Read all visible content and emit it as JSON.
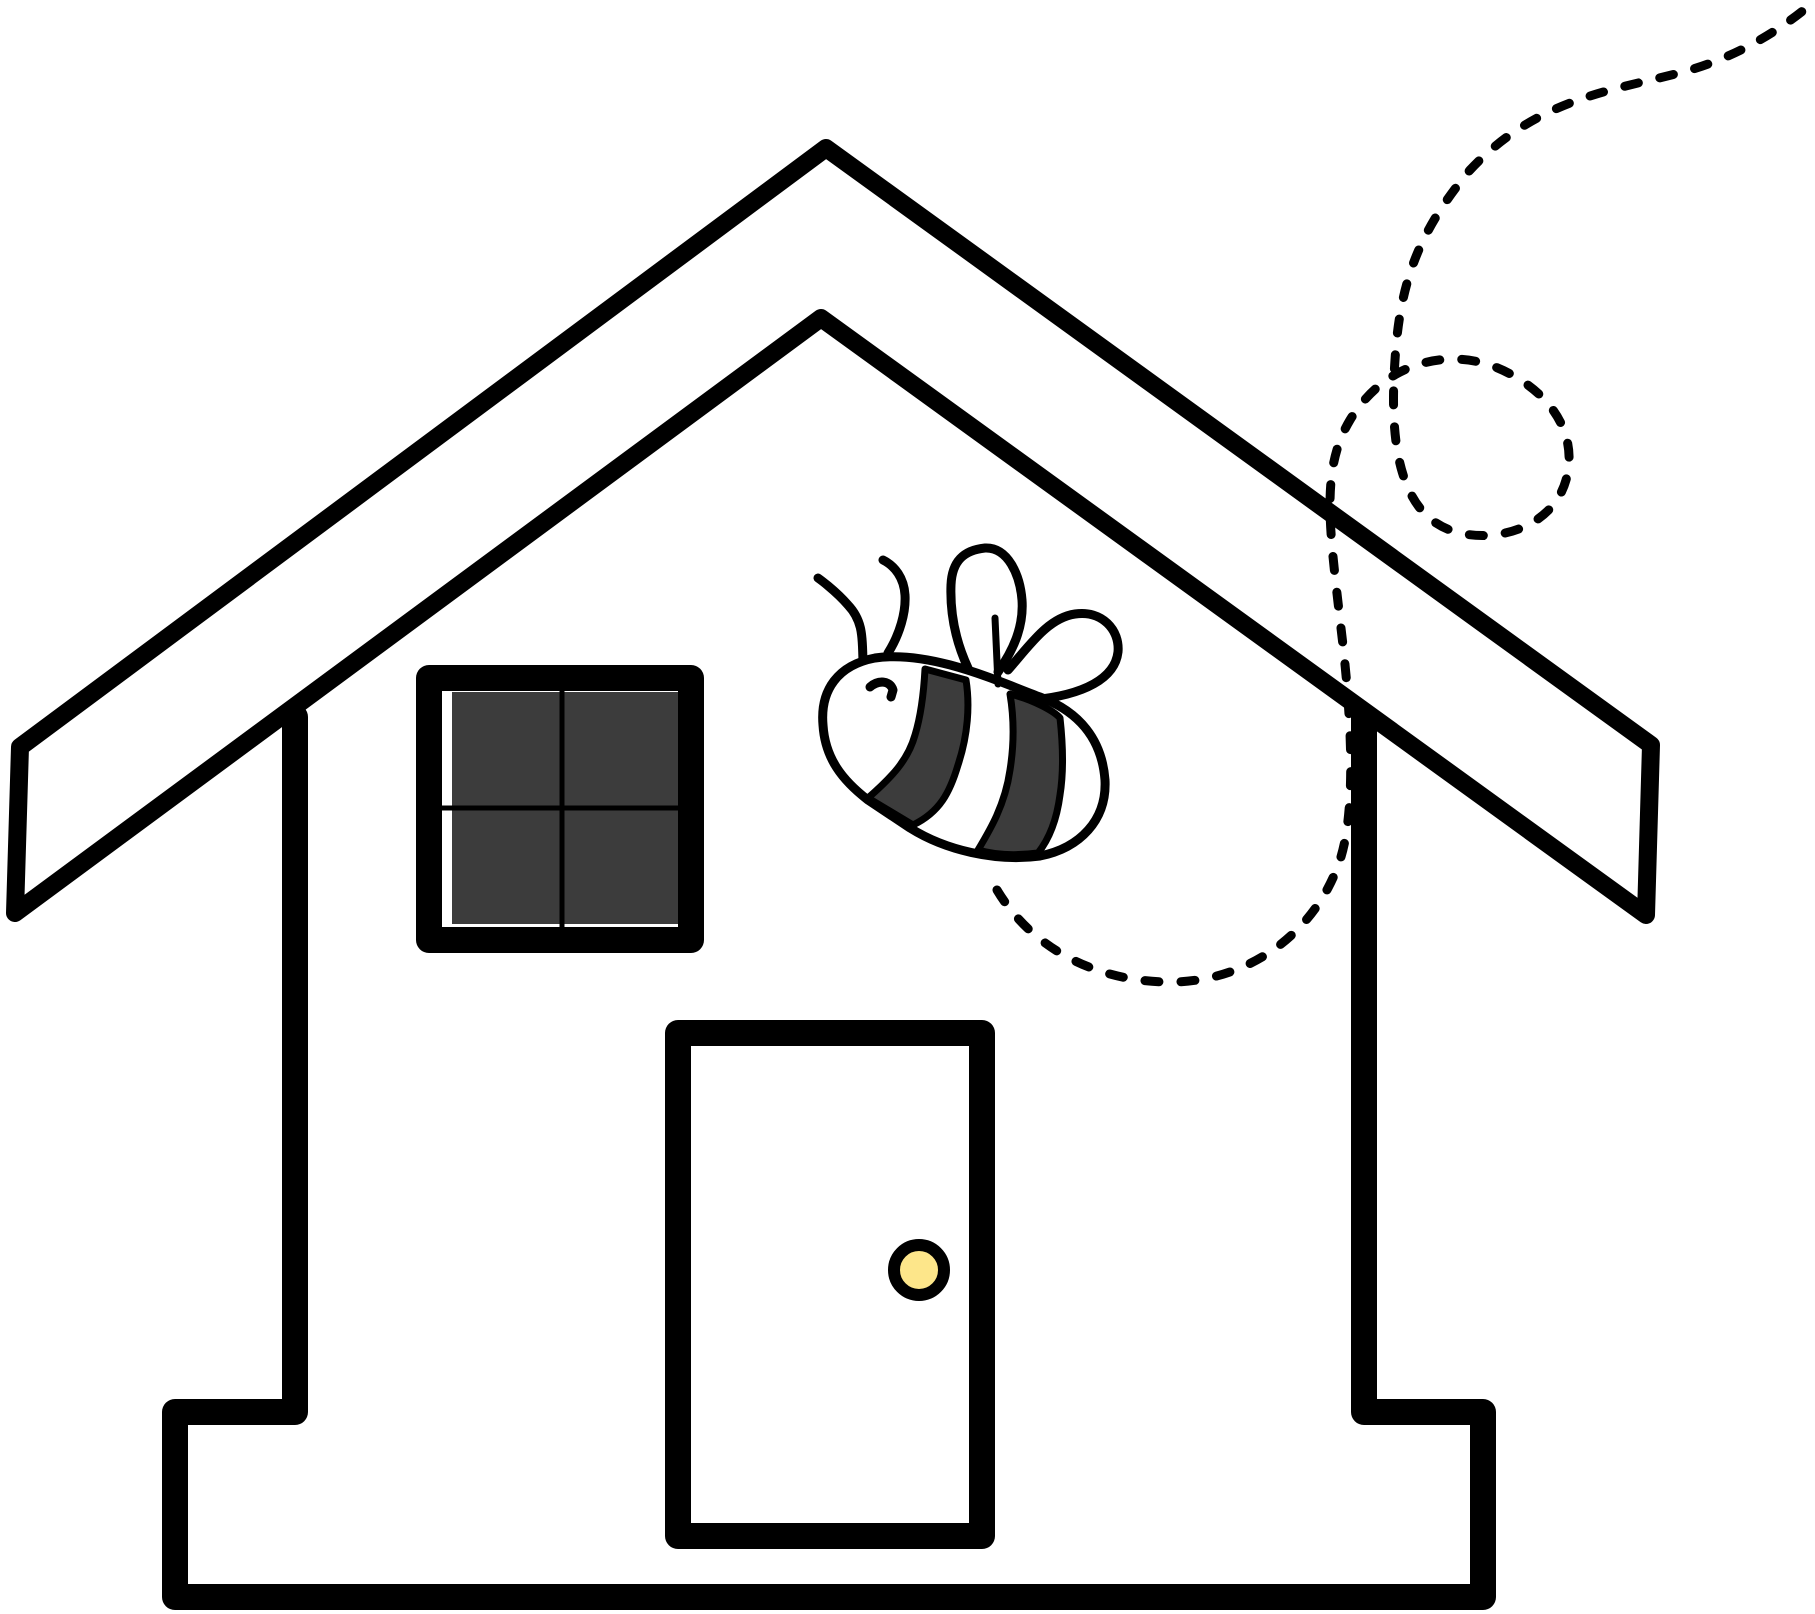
{
  "illustration": {
    "subject": "house-with-bee",
    "colors": {
      "line": "#000000",
      "background": "#ffffff",
      "window_glass": "#3c3c3c",
      "bee_stripe": "#3c3c3c",
      "door_knob": "#fde68a"
    },
    "icons": [
      "house-icon",
      "window-icon",
      "door-icon",
      "door-knob-icon",
      "bee-icon"
    ]
  }
}
